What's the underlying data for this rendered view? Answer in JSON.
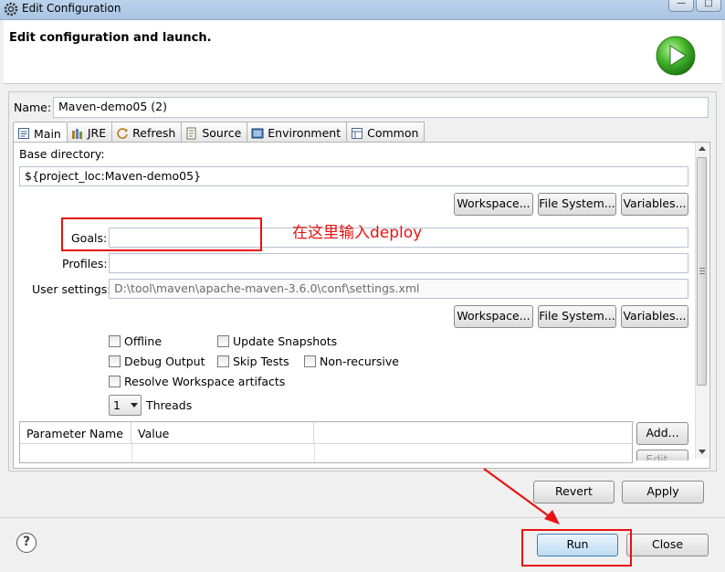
{
  "window": {
    "title": "Edit Configuration",
    "minimize": "—",
    "maximize": "□"
  },
  "banner": {
    "title": "Edit configuration and launch."
  },
  "name": {
    "label": "Name:",
    "value": "Maven-demo05 (2)"
  },
  "tabs": [
    {
      "label": "Main"
    },
    {
      "label": "JRE"
    },
    {
      "label": "Refresh"
    },
    {
      "label": "Source"
    },
    {
      "label": "Environment"
    },
    {
      "label": "Common"
    }
  ],
  "main": {
    "base_directory_label": "Base directory:",
    "base_directory_value": "${project_loc:Maven-demo05}",
    "workspace_label": "Workspace...",
    "filesystem_label": "File System...",
    "variables_label": "Variables...",
    "goals_label": "Goals:",
    "goals_value": "",
    "profiles_label": "Profiles:",
    "profiles_value": "",
    "user_settings_label": "User settings:",
    "user_settings_value": "D:\\tool\\maven\\apache-maven-3.6.0\\conf\\settings.xml",
    "options": {
      "offline": "Offline",
      "update_snapshots": "Update Snapshots",
      "debug_output": "Debug Output",
      "skip_tests": "Skip Tests",
      "non_recursive": "Non-recursive",
      "resolve_workspace": "Resolve Workspace artifacts"
    },
    "threads_value": "1",
    "threads_label": "Threads",
    "params_table": {
      "columns": [
        "Parameter Name",
        "Value"
      ]
    },
    "add_label": "Add...",
    "edit_label": "Edit..."
  },
  "annotation": {
    "text": "在这里输入deploy"
  },
  "footer": {
    "revert_label": "Revert",
    "apply_label": "Apply",
    "run_label": "Run",
    "close_label": "Close",
    "help_label": "?"
  }
}
